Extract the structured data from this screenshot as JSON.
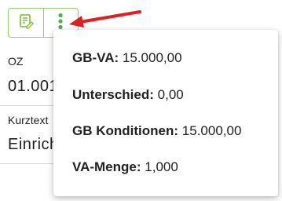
{
  "toolbar": {
    "notes_icon": "notes-pencil-icon",
    "more_icon": "more-vertical-icon",
    "accent_color": "#8bc34a"
  },
  "form": {
    "oz_label": "OZ",
    "oz_value": "01.001",
    "kurztext_label": "Kurztext",
    "kurztext_value": "Einrich"
  },
  "popup": {
    "items": [
      {
        "label": "GB-VA",
        "value": "15.000,00"
      },
      {
        "label": "Unterschied",
        "value": "0,00"
      },
      {
        "label": "GB Konditionen",
        "value": "15.000,00"
      },
      {
        "label": "VA-Menge",
        "value": "1,000"
      }
    ]
  },
  "annotation": {
    "arrow_color": "#e02020"
  }
}
